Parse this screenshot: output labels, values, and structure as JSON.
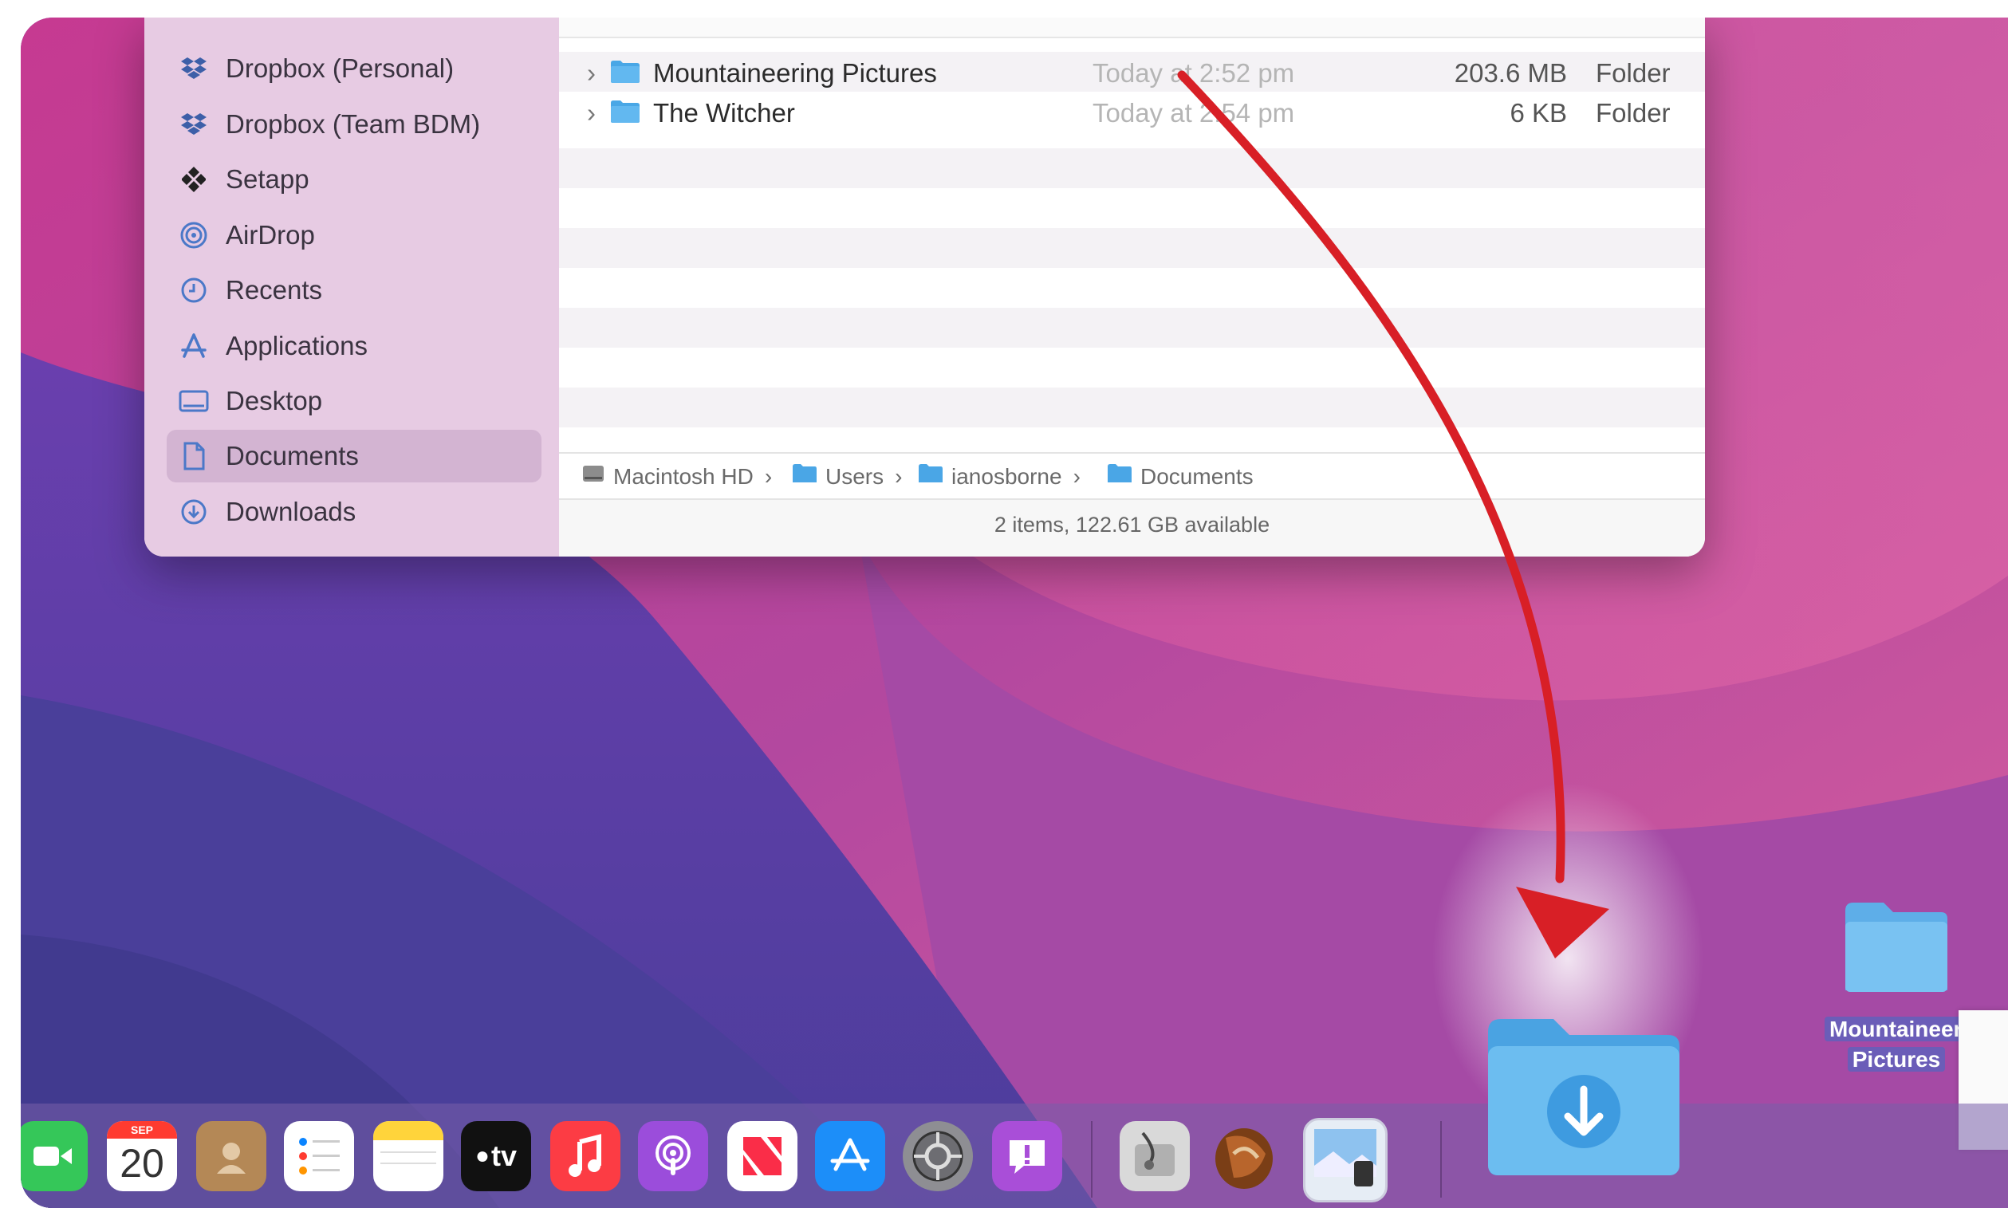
{
  "sidebar": {
    "items": [
      {
        "label": "Dropbox (Personal)",
        "icon": "dropbox-icon"
      },
      {
        "label": "Dropbox (Team BDM)",
        "icon": "dropbox-icon"
      },
      {
        "label": "Setapp",
        "icon": "setapp-icon"
      },
      {
        "label": "AirDrop",
        "icon": "airdrop-icon"
      },
      {
        "label": "Recents",
        "icon": "clock-icon"
      },
      {
        "label": "Applications",
        "icon": "applications-icon"
      },
      {
        "label": "Desktop",
        "icon": "desktop-icon"
      },
      {
        "label": "Documents",
        "icon": "document-icon",
        "selected": true
      },
      {
        "label": "Downloads",
        "icon": "download-icon"
      }
    ]
  },
  "files": [
    {
      "name": "Mountaineering Pictures",
      "date": "Today at 2:52 pm",
      "size": "203.6 MB",
      "kind": "Folder"
    },
    {
      "name": "The Witcher",
      "date": "Today at 2:54 pm",
      "size": "6 KB",
      "kind": "Folder"
    }
  ],
  "path": [
    "Macintosh HD",
    "Users",
    "ianosborne",
    "Documents"
  ],
  "status": "2 items, 122.61 GB available",
  "desktop_folder": {
    "line1": "Mountaineering",
    "line2": "Pictures"
  },
  "dock": {
    "calendar_month": "SEP",
    "calendar_day": "20",
    "apps": [
      "facetime-icon",
      "calendar-icon",
      "contacts-icon",
      "reminders-icon",
      "notes-icon",
      "appletv-icon",
      "music-icon",
      "podcasts-icon",
      "news-icon",
      "appstore-icon",
      "system-preferences-icon",
      "feedback-icon",
      "disk-utility-icon",
      "marble-icon",
      "preview-icon",
      "downloads-folder-icon"
    ],
    "tv_label": "tv"
  },
  "colors": {
    "accent_red": "#d81f26",
    "folder_blue": "#6cbdf0"
  }
}
